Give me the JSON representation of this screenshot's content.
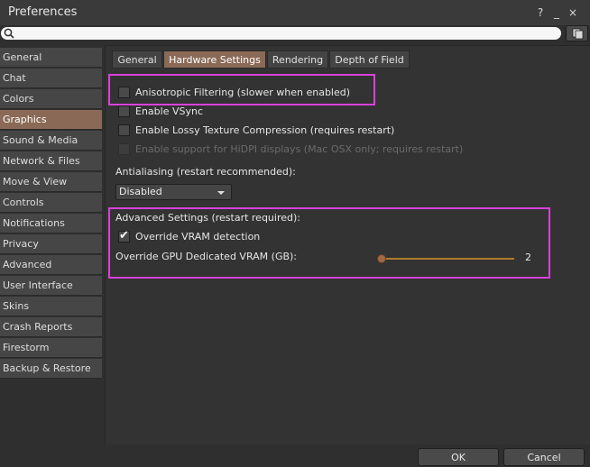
{
  "window": {
    "title": "Preferences",
    "help_icon": "?",
    "minimize_icon": "_",
    "close_icon": "×"
  },
  "search": {
    "value": "",
    "placeholder": ""
  },
  "sidebar": {
    "items": [
      {
        "label": "General"
      },
      {
        "label": "Chat"
      },
      {
        "label": "Colors"
      },
      {
        "label": "Graphics",
        "selected": true
      },
      {
        "label": "Sound & Media"
      },
      {
        "label": "Network & Files"
      },
      {
        "label": "Move & View"
      },
      {
        "label": "Controls"
      },
      {
        "label": "Notifications"
      },
      {
        "label": "Privacy"
      },
      {
        "label": "Advanced"
      },
      {
        "label": "User Interface"
      },
      {
        "label": "Skins"
      },
      {
        "label": "Crash Reports"
      },
      {
        "label": "Firestorm"
      },
      {
        "label": "Backup & Restore"
      }
    ]
  },
  "tabs": [
    {
      "label": "General"
    },
    {
      "label": "Hardware Settings",
      "active": true
    },
    {
      "label": "Rendering"
    },
    {
      "label": "Depth of Field"
    }
  ],
  "options": {
    "anisotropic": {
      "label": "Anisotropic Filtering (slower when enabled)",
      "checked": false
    },
    "vsync": {
      "label": "Enable VSync",
      "checked": false
    },
    "lossy_texture": {
      "label": "Enable Lossy Texture Compression (requires restart)",
      "checked": false
    },
    "hidpi": {
      "label": "Enable support for HiDPI displays (Mac OSX only; requires restart)",
      "checked": false,
      "disabled": true
    }
  },
  "antialiasing": {
    "label": "Antialiasing (restart recommended):",
    "value": "Disabled"
  },
  "advanced": {
    "heading": "Advanced Settings (restart required):",
    "override_vram": {
      "label": "Override VRAM detection",
      "checked": true
    },
    "gpu_vram_label": "Override GPU Dedicated VRAM (GB):",
    "gpu_vram_value": "2"
  },
  "buttons": {
    "ok": "OK",
    "cancel": "Cancel"
  },
  "colors": {
    "accent_selected": "#8a6a57",
    "highlight_box": "#d942d9",
    "slider": "#b07a30"
  }
}
